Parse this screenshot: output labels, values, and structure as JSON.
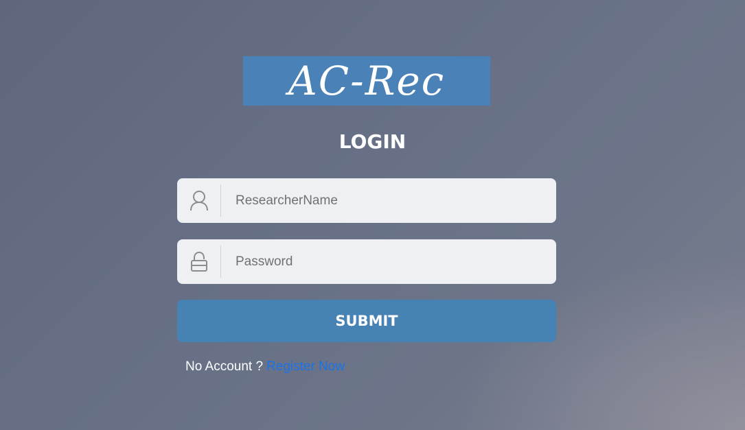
{
  "logo": {
    "text": "AC-Rec",
    "background_color": "#4a82b7"
  },
  "login": {
    "title": "LOGIN"
  },
  "username_field": {
    "value": "",
    "placeholder": "ResearcherName",
    "icon": "user-icon"
  },
  "password_field": {
    "value": "",
    "placeholder": "Password",
    "icon": "lock-icon"
  },
  "submit": {
    "label": "SUBMIT",
    "color": "#4682b4"
  },
  "register": {
    "prompt": "No Account ?",
    "link_label": "Register Now",
    "link_color": "#1a73e8"
  }
}
